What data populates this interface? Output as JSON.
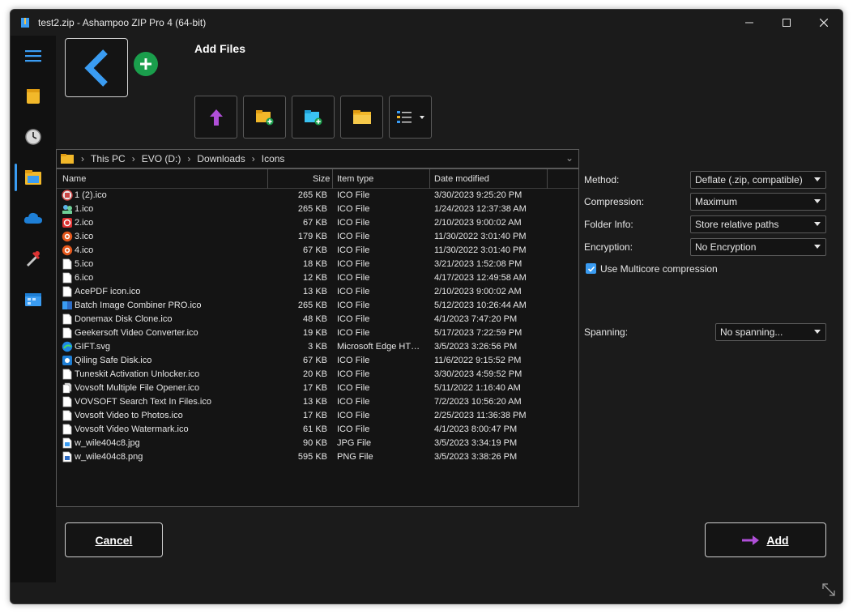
{
  "window": {
    "title": "test2.zip - Ashampoo ZIP Pro 4 (64-bit)"
  },
  "header": {
    "title": "Add Files"
  },
  "rail": [
    "menu-icon",
    "notes-icon",
    "clock-icon",
    "file-explorer-icon",
    "cloud-icon",
    "tools-icon",
    "calendar-icon"
  ],
  "breadcrumb": [
    "This PC",
    "EVO (D:)",
    "Downloads",
    "Icons"
  ],
  "columns": {
    "name": "Name",
    "size": "Size",
    "type": "Item type",
    "date": "Date modified"
  },
  "files": [
    {
      "name": "1 (2).ico",
      "size": "265 KB",
      "type": "ICO File",
      "date": "3/30/2023 9:25:20 PM",
      "icon": "film-icon"
    },
    {
      "name": "1.ico",
      "size": "265 KB",
      "type": "ICO File",
      "date": "1/24/2023 12:37:38 AM",
      "icon": "people-icon"
    },
    {
      "name": "2.ico",
      "size": "67 KB",
      "type": "ICO File",
      "date": "2/10/2023 9:00:02 AM",
      "icon": "recycle-icon"
    },
    {
      "name": "3.ico",
      "size": "179 KB",
      "type": "ICO File",
      "date": "11/30/2022 3:01:40 PM",
      "icon": "orange-circle-icon"
    },
    {
      "name": "4.ico",
      "size": "67 KB",
      "type": "ICO File",
      "date": "11/30/2022 3:01:40 PM",
      "icon": "orange-circle-icon"
    },
    {
      "name": "5.ico",
      "size": "18 KB",
      "type": "ICO File",
      "date": "3/21/2023 1:52:08 PM",
      "icon": "document-icon"
    },
    {
      "name": "6.ico",
      "size": "12 KB",
      "type": "ICO File",
      "date": "4/17/2023 12:49:58 AM",
      "icon": "document-icon"
    },
    {
      "name": "AcePDF icon.ico",
      "size": "13 KB",
      "type": "ICO File",
      "date": "2/10/2023 9:00:02 AM",
      "icon": "document-icon"
    },
    {
      "name": "Batch Image Combiner PRO.ico",
      "size": "265 KB",
      "type": "ICO File",
      "date": "5/12/2023 10:26:44 AM",
      "icon": "image-combiner-icon"
    },
    {
      "name": "Donemax Disk Clone.ico",
      "size": "48 KB",
      "type": "ICO File",
      "date": "4/1/2023 7:47:20 PM",
      "icon": "document-icon"
    },
    {
      "name": "Geekersoft Video Converter.ico",
      "size": "19 KB",
      "type": "ICO File",
      "date": "5/17/2023 7:22:59 PM",
      "icon": "document-icon"
    },
    {
      "name": "GIFT.svg",
      "size": "3 KB",
      "type": "Microsoft Edge HT…",
      "date": "3/5/2023 3:26:56 PM",
      "icon": "edge-icon"
    },
    {
      "name": "Qiling Safe Disk.ico",
      "size": "67 KB",
      "type": "ICO File",
      "date": "11/6/2022 9:15:52 PM",
      "icon": "safe-disk-icon"
    },
    {
      "name": "Tuneskit Activation Unlocker.ico",
      "size": "20 KB",
      "type": "ICO File",
      "date": "3/30/2023 4:59:52 PM",
      "icon": "document-icon"
    },
    {
      "name": "Vovsoft Multiple File Opener.ico",
      "size": "17 KB",
      "type": "ICO File",
      "date": "5/11/2022 1:16:40 AM",
      "icon": "multi-file-icon"
    },
    {
      "name": "VOVSOFT Search Text In Files.ico",
      "size": "13 KB",
      "type": "ICO File",
      "date": "7/2/2023 10:56:20 AM",
      "icon": "document-icon"
    },
    {
      "name": "Vovsoft Video to Photos.ico",
      "size": "17 KB",
      "type": "ICO File",
      "date": "2/25/2023 11:36:38 PM",
      "icon": "document-icon"
    },
    {
      "name": "Vovsoft Video Watermark.ico",
      "size": "61 KB",
      "type": "ICO File",
      "date": "4/1/2023 8:00:47 PM",
      "icon": "document-icon"
    },
    {
      "name": "w_wile404c8.jpg",
      "size": "90 KB",
      "type": "JPG File",
      "date": "3/5/2023 3:34:19 PM",
      "icon": "jpg-icon"
    },
    {
      "name": "w_wile404c8.png",
      "size": "595 KB",
      "type": "PNG File",
      "date": "3/5/2023 3:38:26 PM",
      "icon": "png-icon"
    }
  ],
  "options": {
    "method_label": "Method:",
    "method_value": "Deflate (.zip, compatible)",
    "compression_label": "Compression:",
    "compression_value": "Maximum",
    "folder_label": "Folder Info:",
    "folder_value": "Store relative paths",
    "encryption_label": "Encryption:",
    "encryption_value": "No Encryption",
    "multicore_label": "Use Multicore compression",
    "multicore_checked": true,
    "spanning_label": "Spanning:",
    "spanning_value": "No spanning..."
  },
  "buttons": {
    "cancel": "Cancel",
    "add": "Add"
  },
  "colors": {
    "accent": "#3a9cf2",
    "background": "#1b1b1b",
    "green": "#1a9e4c",
    "purple": "#b04fd8"
  }
}
